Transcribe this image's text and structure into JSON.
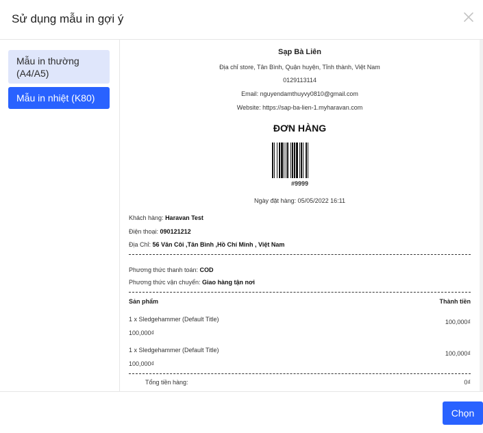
{
  "dialog": {
    "title": "Sử dụng mẫu in gợi ý"
  },
  "sidebar": {
    "items": [
      {
        "label": "Mẫu in thường (A4/A5)"
      },
      {
        "label": "Mẫu in nhiệt (K80)"
      }
    ]
  },
  "receipt": {
    "store_name": "Sạp Bà Liên",
    "address": "Địa chỉ store, Tân Bình, Quận huyện, Tỉnh thành, Việt Nam",
    "phone": "0129113114",
    "email": "Email: nguyendamthuyvy0810@gmail.com",
    "website": "Website: https://sap-ba-lien-1.myharavan.com",
    "doc_title": "ĐƠN HÀNG",
    "order_code": "#9999",
    "order_date": "Ngày đặt hàng: 05/05/2022 16:11",
    "customer_label": "Khách hàng:",
    "customer_value": "Haravan Test",
    "phone_label": "Điện thoại:",
    "phone_value": "090121212",
    "address_label": "Địa Chỉ:",
    "address_value": "56 Văn Côi ,Tân Bình ,Hồ Chí Minh , Việt Nam",
    "payment_label": "Phương thức thanh toán:",
    "payment_value": "COD",
    "shipping_label": "Phương thức vận chuyển:",
    "shipping_value": "Giao hàng tận nơi",
    "col_product": "Sản phẩm",
    "col_total": "Thành tiền",
    "items": [
      {
        "name": "1 x Sledgehammer (Default Title)",
        "price": "100,000₫",
        "total": "100,000₫"
      },
      {
        "name": "1 x Sledgehammer (Default Title)",
        "price": "100,000₫",
        "total": "100,000₫"
      }
    ],
    "subtotal_label": "Tổng tiền hàng:",
    "subtotal_value": "0₫"
  },
  "footer": {
    "choose_label": "Chọn"
  },
  "colors": {
    "primary": "#2962ff",
    "selected_light": "#dfe6fb"
  },
  "icons": {
    "close": "close-icon"
  }
}
